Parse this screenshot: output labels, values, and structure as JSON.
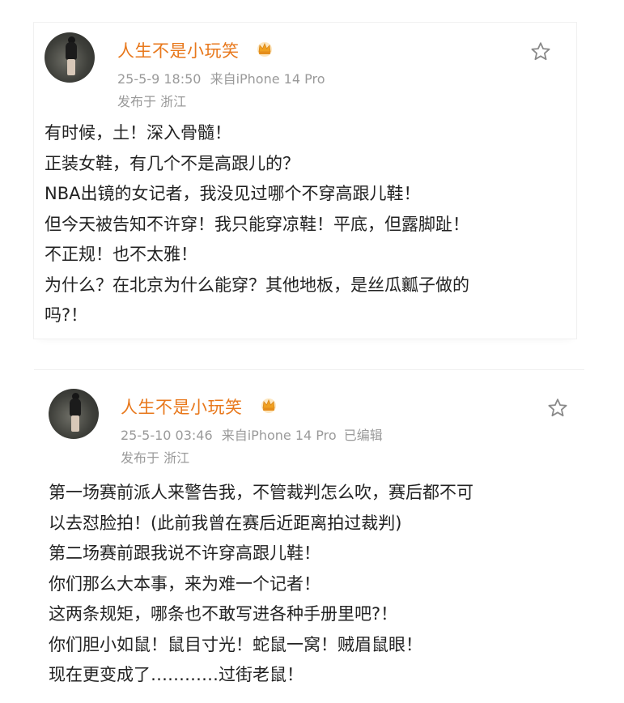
{
  "posts": [
    {
      "username": "人生不是小玩笑",
      "date": "25-5-9 18:50",
      "source": "来自iPhone 14 Pro",
      "location": "发布于 浙江",
      "lines": [
        "有时候，土！深入骨髓！",
        "正装女鞋，有几个不是高跟儿的？",
        "NBA出镜的女记者，我没见过哪个不穿高跟儿鞋！",
        "但今天被告知不许穿！我只能穿凉鞋！平底，但露脚趾！",
        "不正规！也不太雅！",
        "为什么？在北京为什么能穿？其他地板，是丝瓜瓤子做的",
        "吗?！"
      ]
    },
    {
      "username": "人生不是小玩笑",
      "date": "25-5-10 03:46",
      "source": "来自iPhone 14 Pro",
      "edited": "已编辑",
      "location": "发布于 浙江",
      "lines": [
        "第一场赛前派人来警告我，不管裁判怎么吹，赛后都不可",
        "以去怼脸拍！(此前我曾在赛后近距离拍过裁判)",
        "第二场赛前跟我说不许穿高跟儿鞋！",
        "你们那么大本事，来为难一个记者！",
        "这两条规矩，哪条也不敢写进各种手册里吧?！",
        "你们胆小如鼠！鼠目寸光！蛇鼠一窝！贼眉鼠眼！",
        "现在更变成了…………过街老鼠！"
      ]
    }
  ],
  "colors": {
    "username": "#e8781c",
    "meta": "#9a9a9a",
    "body": "#222222",
    "star_outline": "#8a8a8a",
    "crown": "#f0a020"
  },
  "icons": {
    "favorite": "star-outline-icon",
    "verified": "crown-badge-icon"
  }
}
